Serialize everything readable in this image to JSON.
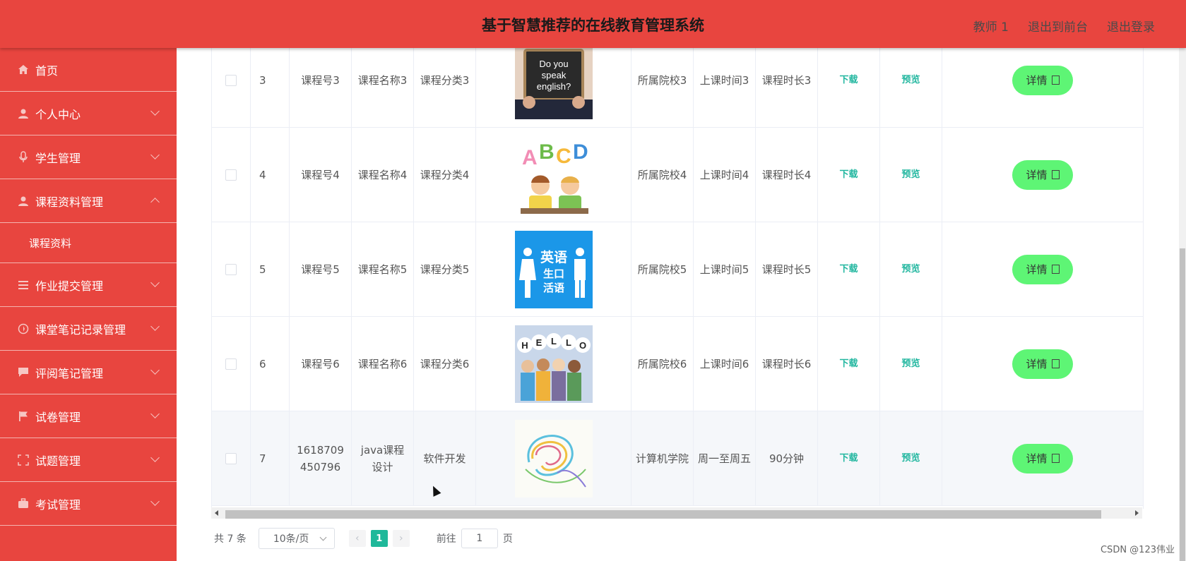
{
  "header": {
    "title": "基于智慧推荐的在线教育管理系统",
    "user_label": "教师 1",
    "to_front_label": "退出到前台",
    "logout_label": "退出登录"
  },
  "sidebar": {
    "items": [
      {
        "label": "首页",
        "icon": "home-icon"
      },
      {
        "label": "个人中心",
        "icon": "user-icon"
      },
      {
        "label": "学生管理",
        "icon": "microphone-icon"
      },
      {
        "label": "课程资料管理",
        "icon": "user-icon"
      },
      {
        "label": "作业提交管理",
        "icon": "list-icon"
      },
      {
        "label": "课堂笔记记录管理",
        "icon": "compass-icon"
      },
      {
        "label": "评阅笔记管理",
        "icon": "chat-icon"
      },
      {
        "label": "试卷管理",
        "icon": "flag-icon"
      },
      {
        "label": "试题管理",
        "icon": "fullscreen-icon"
      },
      {
        "label": "考试管理",
        "icon": "briefcase-icon"
      }
    ],
    "sub_item": "课程资料"
  },
  "table": {
    "rows": [
      {
        "index": "3",
        "course_no": "课程号3",
        "course_name": "课程名称3",
        "category": "课程分类3",
        "image": "speak-english-photo",
        "school": "所属院校3",
        "time": "上课时间3",
        "duration": "课程时长3"
      },
      {
        "index": "4",
        "course_no": "课程号4",
        "course_name": "课程名称4",
        "category": "课程分类4",
        "image": "abcd-kids-illustration",
        "school": "所属院校4",
        "time": "上课时间4",
        "duration": "课程时长4"
      },
      {
        "index": "5",
        "course_no": "课程号5",
        "course_name": "课程名称5",
        "category": "课程分类5",
        "image": "english-speaking-blue-sign",
        "school": "所属院校5",
        "time": "上课时间5",
        "duration": "课程时长5"
      },
      {
        "index": "6",
        "course_no": "课程号6",
        "course_name": "课程名称6",
        "category": "课程分类6",
        "image": "hello-people-illustration",
        "school": "所属院校6",
        "time": "上课时间6",
        "duration": "课程时长6"
      },
      {
        "index": "7",
        "course_no": "1618709450796",
        "course_name": "java课程设计",
        "category": "软件开发",
        "image": "abstract-swirl-image",
        "school": "计算机学院",
        "time": "周一至周五",
        "duration": "90分钟"
      }
    ],
    "download_label": "下载",
    "preview_label": "预览",
    "detail_label": "详情"
  },
  "pagination": {
    "total": "共 7 条",
    "page_size": "10条/页",
    "current_page": "1",
    "goto_prefix": "前往",
    "goto_value": "1",
    "goto_suffix": "页"
  },
  "watermark": "CSDN @123伟业"
}
